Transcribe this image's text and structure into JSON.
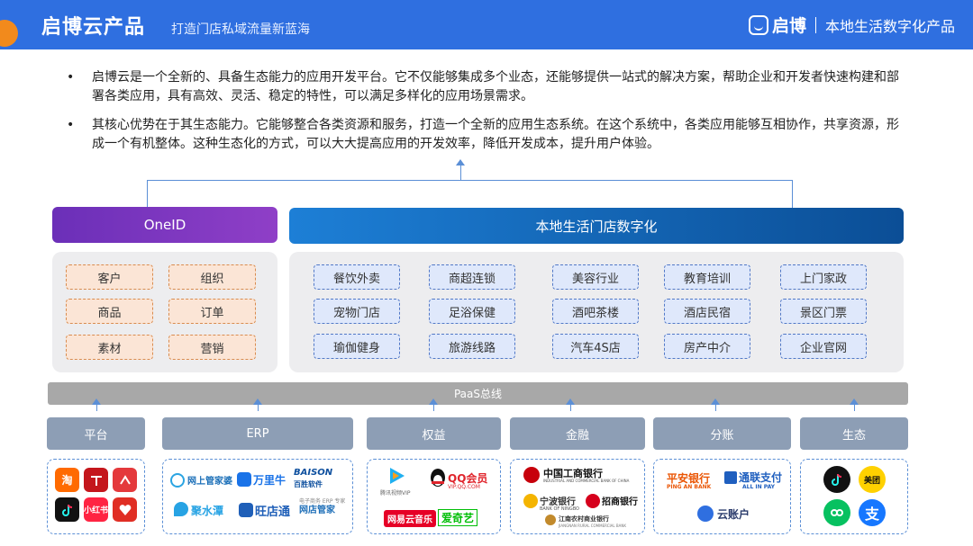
{
  "header": {
    "title": "启博云产品",
    "subtitle": "打造门店私域流量新蓝海",
    "brand_name": "启博",
    "brand_tagline": "本地生活数字化产品",
    "accent_color": "#2f6fe0"
  },
  "bullets": [
    {
      "mark": "•",
      "text": "启博云是一个全新的、具备生态能力的应用开发平台。它不仅能够集成多个业态，还能够提供一站式的解决方案，帮助企业和开发者快速构建和部署各类应用，具有高效、灵活、稳定的特性，可以满足多样化的应用场景需求。"
    },
    {
      "mark": "•",
      "text": "其核心优势在于其生态能力。它能够整合各类资源和服务，打造一个全新的应用生态系统。在这个系统中，各类应用能够互相协作，共享资源，形成一个有机整体。这种生态化的方式，可以大大提高应用的开发效率，降低开发成本，提升用户体验。"
    }
  ],
  "oneid": {
    "title": "OneID",
    "items": [
      "客户",
      "组织",
      "商品",
      "订单",
      "素材",
      "营销"
    ]
  },
  "local": {
    "title": "本地生活门店数字化",
    "items": [
      "餐饮外卖",
      "商超连锁",
      "美容行业",
      "教育培训",
      "上门家政",
      "宠物门店",
      "足浴保健",
      "酒吧茶楼",
      "酒店民宿",
      "景区门票",
      "瑜伽健身",
      "旅游线路",
      "汽车4S店",
      "房产中介",
      "企业官网"
    ]
  },
  "paas": {
    "label": "PaaS总线"
  },
  "categories": [
    "平台",
    "ERP",
    "权益",
    "金融",
    "分账",
    "生态"
  ],
  "logos": {
    "platform": [
      "淘",
      "小红书"
    ],
    "erp": [
      "网上管家婆",
      "万里牛",
      "BAISON",
      "百胜软件",
      "聚水潭",
      "旺店通",
      "网店管家",
      "电子商务 ERP 专家"
    ],
    "rights": [
      "腾讯视频VIP",
      "QQ会员",
      "VIP.QQ.COM",
      "网易云音乐",
      "爱奇艺"
    ],
    "finance": [
      "中国工商银行",
      "INDUSTRIAL AND COMMERCIAL BANK OF CHINA",
      "宁波银行",
      "BANK OF NINGBO",
      "招商银行",
      "江南农村商业银行",
      "JIANGNAN RURAL COMMERCIAL BANK"
    ],
    "split": [
      "平安银行",
      "PING AN BANK",
      "通联支付",
      "ALL IN PAY",
      "云账户"
    ],
    "eco": [
      "美团",
      "支"
    ]
  }
}
